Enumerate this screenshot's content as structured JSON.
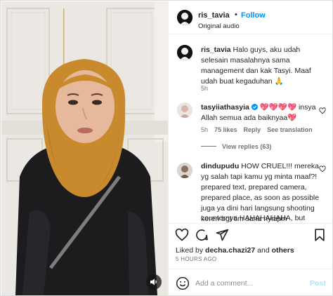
{
  "header": {
    "username": "ris_tavia",
    "separator": "•",
    "follow_label": "Follow",
    "audio_label": "Original audio"
  },
  "caption": {
    "username": "ris_tavia",
    "text": " Halo guys, aku udah selesain masalahnya sama management dan kak Tasyi. Maaf udah buat kegaduhan ",
    "emoji": "🙏",
    "time": "5h"
  },
  "comments": [
    {
      "username": "tasyiiathasyia",
      "verified": true,
      "line1_tail": "💖💖💖💖 insya",
      "line2": "Allah semua ada baiknyaa💖",
      "time": "5h",
      "likes": "75 likes",
      "reply_label": "Reply",
      "translate_label": "See translation",
      "view_replies": "View replies (63)"
    },
    {
      "username": "dindupudu",
      "lines": [
        " HOW CRUEL!!! mereka",
        "yg salah tapi kamu yg minta maaf?!",
        "prepared text, prepared camera,",
        "prepared place, as soon as possible",
        "juga ya dini hari langsung shooting",
        "keren bgt tim sana nyiapin",
        "counternya HAHAHAHAHA, but"
      ]
    }
  ],
  "actions": {
    "liked_by_prefix": "Liked by ",
    "liked_by_user": "decha.chazi27",
    "liked_by_mid": " and ",
    "liked_by_others": "others",
    "time_ago": "5 HOURS AGO"
  },
  "add_comment": {
    "placeholder": "Add a comment...",
    "post_label": "Post"
  },
  "colors": {
    "accent": "#0095f6",
    "post_disabled": "#b2dffc",
    "muted": "#737373",
    "hijab": "#c98a2e"
  },
  "icons": [
    "heart-icon",
    "comment-icon",
    "share-icon",
    "bookmark-icon",
    "emoji-icon",
    "verified-icon",
    "speaker-icon"
  ]
}
